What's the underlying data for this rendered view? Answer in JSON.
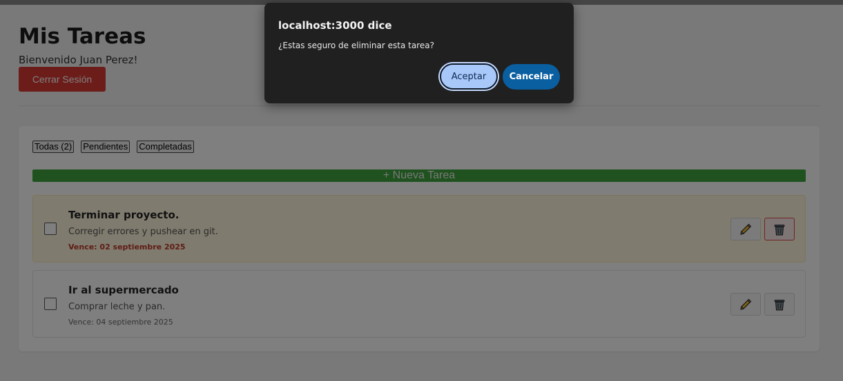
{
  "header": {
    "title": "Mis Tareas",
    "welcome": "Bienvenido Juan Perez!",
    "logout_label": "Cerrar Sesión"
  },
  "filters": [
    {
      "label": "Todas (2)"
    },
    {
      "label": "Pendientes"
    },
    {
      "label": "Completadas"
    }
  ],
  "new_task_label": "+ Nueva Tarea",
  "tasks": [
    {
      "title": "Terminar proyecto.",
      "description": "Corregir errores y pushear en git.",
      "due": "Vence: 02 septiembre 2025",
      "completed": false,
      "overdue": true
    },
    {
      "title": "Ir al supermercado",
      "description": "Comprar leche y pan.",
      "due": "Vence: 04 septiembre 2025",
      "completed": false,
      "overdue": false
    }
  ],
  "icons": {
    "edit": "pencil-icon",
    "delete": "trash-icon"
  },
  "dialog": {
    "title": "localhost:3000 dice",
    "message": "¿Estas seguro de eliminar esta tarea?",
    "accept_label": "Aceptar",
    "cancel_label": "Cancelar"
  },
  "colors": {
    "logout": "#d93a35",
    "new_task": "#3ea43e",
    "overdue_bg": "#fff7dc",
    "overdue_due": "#c0392b",
    "dialog_bg": "#202020",
    "accept_bg": "#a9c8fa",
    "cancel_bg": "#0a5fa1"
  }
}
